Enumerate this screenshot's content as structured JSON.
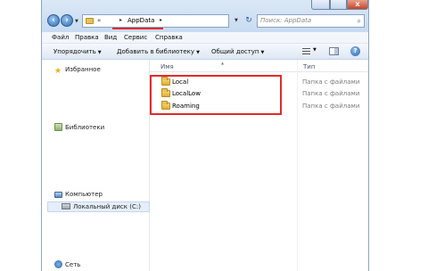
{
  "window": {
    "close_label": "x"
  },
  "address_bar": {
    "chevrons": "«",
    "separator": "▸",
    "crumb": "AppData"
  },
  "search": {
    "placeholder": "Поиск: AppData",
    "icon": "search-icon"
  },
  "menu": {
    "file": "Файл",
    "edit": "Правка",
    "view": "Вид",
    "service": "Сервис",
    "help": "Справка"
  },
  "toolbar": {
    "organize": "Упорядочить",
    "library": "Добавить в библиотеку",
    "share": "Общий доступ",
    "help_icon": "?"
  },
  "nav": {
    "favorites": "Избранное",
    "libraries": "Библиотеки",
    "computer": "Компьютер",
    "local_disk": "Локальный диск (C:)",
    "network": "Сеть"
  },
  "columns": {
    "name": "Имя",
    "type": "Тип"
  },
  "files": [
    {
      "name": "Local",
      "type": "Папка с файлами"
    },
    {
      "name": "LocalLow",
      "type": "Папка с файлами"
    },
    {
      "name": "Roaming",
      "type": "Папка с файлами"
    }
  ],
  "colors": {
    "annotation_red": "#e32a2a",
    "toolbar_blue": "#dde8f4",
    "folder_yellow": "#e0ae2c"
  }
}
